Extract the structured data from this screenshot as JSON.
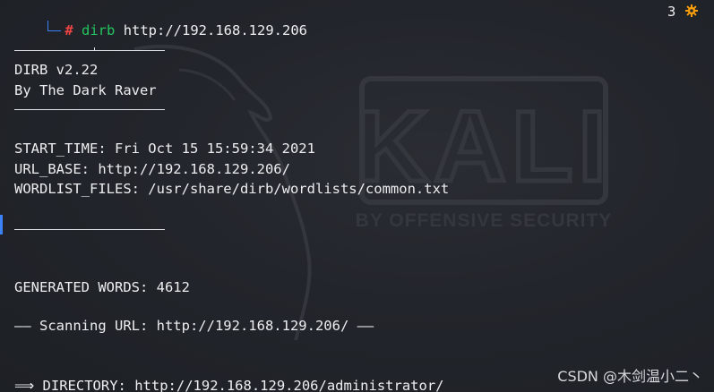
{
  "prompt": {
    "symbol": "#",
    "command": "dirb",
    "argument": "http://192.168.129.206"
  },
  "status": {
    "count": "3"
  },
  "output": {
    "version": "DIRB v2.22",
    "author": "By The Dark Raver",
    "start_time": "START_TIME: Fri Oct 15 15:59:34 2021",
    "url_base": "URL_BASE: http://192.168.129.206/",
    "wordlist": "WORDLIST_FILES: /usr/share/dirb/wordlists/common.txt",
    "generated_words": "GENERATED WORDS: 4612",
    "scanning": "—— Scanning URL: http://192.168.129.206/ ——",
    "directory": "⟹ DIRECTORY: http://192.168.129.206/administrator/"
  },
  "watermark": {
    "logo_text": "KALI",
    "tagline": "BY OFFENSIVE SECURITY",
    "source": "CSDN @木剑温小二丶"
  },
  "colors": {
    "background": "#22252b",
    "text": "#eceef0",
    "prompt_hash": "#ef4444",
    "prompt_command": "#22c55e",
    "prompt_corner": "#3b82f6",
    "gear": "#f59e0b"
  },
  "icons": {
    "status": "gear-icon",
    "prompt": "corner-bracket-icon"
  }
}
